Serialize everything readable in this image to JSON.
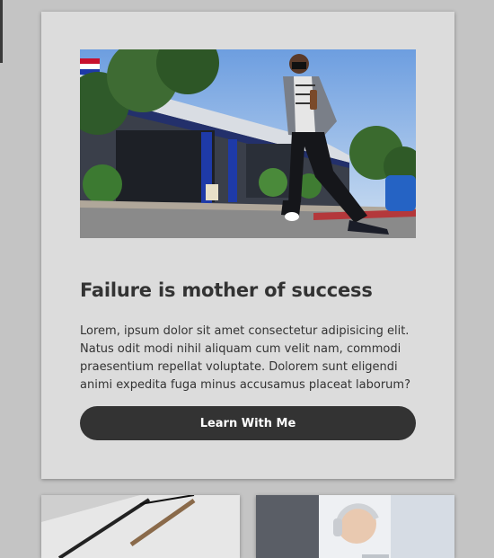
{
  "main_card": {
    "title": "Failure is mother of success",
    "body": "Lorem, ipsum dolor sit amet consectetur adipisicing elit. Natus odit modi nihil aliquam cum velit nam, commodi praesentium repellat voluptate. Dolorem sunt eligendi animi expedita fuga minus accusamus placeat laborum?",
    "button_label": "Learn With Me"
  },
  "colors": {
    "page_background": "#c4c4c4",
    "card_background": "#dcdcdc",
    "button_background": "#333333",
    "button_text": "#ffffff",
    "text": "#333333"
  }
}
